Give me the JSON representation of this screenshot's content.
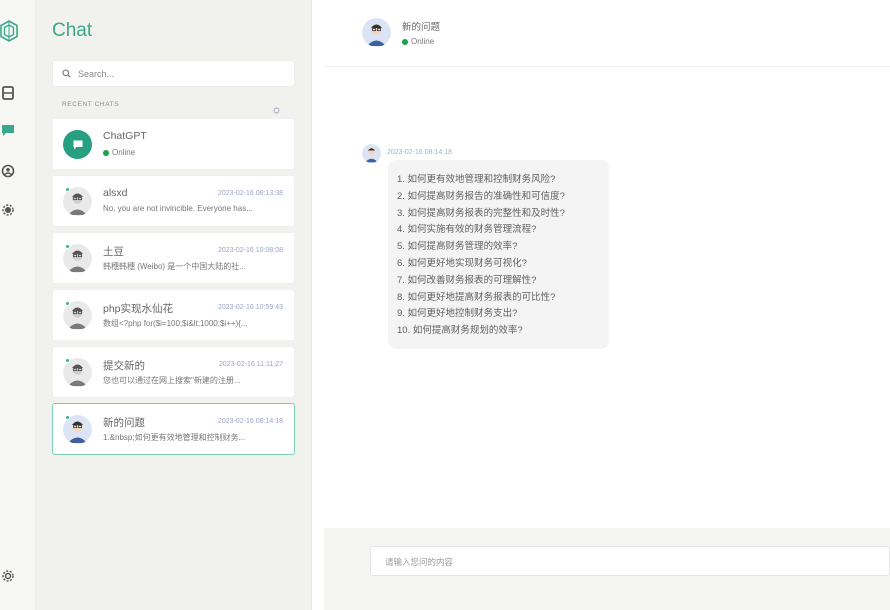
{
  "panel": {
    "title": "Chat"
  },
  "search": {
    "placeholder": "Search..."
  },
  "recent": {
    "label": "RECENT CHATS"
  },
  "chats": [
    {
      "name": "ChatGPT",
      "status": "Online",
      "time": "",
      "preview": ""
    },
    {
      "name": "alsxd",
      "time": "2023-02-16 08:13:38",
      "preview": "No, you are not invincible. Everyone has..."
    },
    {
      "name": "土豆",
      "time": "2023-02-16 10:08:08",
      "preview": "韩穗韩穗 (Weibo) 是一个中国大陆的社..."
    },
    {
      "name": "php实现水仙花",
      "time": "2023-02-16 10:59:43",
      "preview": "数组<?php for($i=100;$i&lt;1000;$i++){..."
    },
    {
      "name": "提交新的",
      "time": "2023-02-16 11:11:27",
      "preview": "您也可以通过在网上搜索\"新建的注册..."
    },
    {
      "name": "新的问题",
      "time": "2023-02-16 08:14:18",
      "preview": "1.&nbsp;如何更有效地管理和控制财务..."
    }
  ],
  "header": {
    "name": "新的问题",
    "status": "Online"
  },
  "message": {
    "time": "2023-02-16 08:14:18",
    "lines": [
      "1. 如何更有效地管理和控制财务风险?",
      "2. 如何提高财务报告的准确性和可信度?",
      "3. 如何提高财务报表的完整性和及时性?",
      "4. 如何实施有效的财务管理流程?",
      "5. 如何提高财务管理的效率?",
      "6. 如何更好地实现财务可视化?",
      "7. 如何改善财务报表的可理解性?",
      "8. 如何更好地提高财务报表的可比性?",
      "9. 如何更好地控制财务支出?",
      "10. 如何提高财务规划的效率?"
    ]
  },
  "composer": {
    "placeholder": "请输入您问的内容"
  },
  "icons": {
    "logo": "hexagon-logo-icon",
    "rail": [
      "archive-box-icon",
      "chat-bubble-icon",
      "contacts-icon",
      "settings-gear-icon",
      "settings-cog-icon"
    ],
    "search": "search-icon",
    "recent": "refresh-icon"
  },
  "colors": {
    "accent": "#3aa88c",
    "online": "#16a34a",
    "active_border": "#7ccdb8"
  }
}
